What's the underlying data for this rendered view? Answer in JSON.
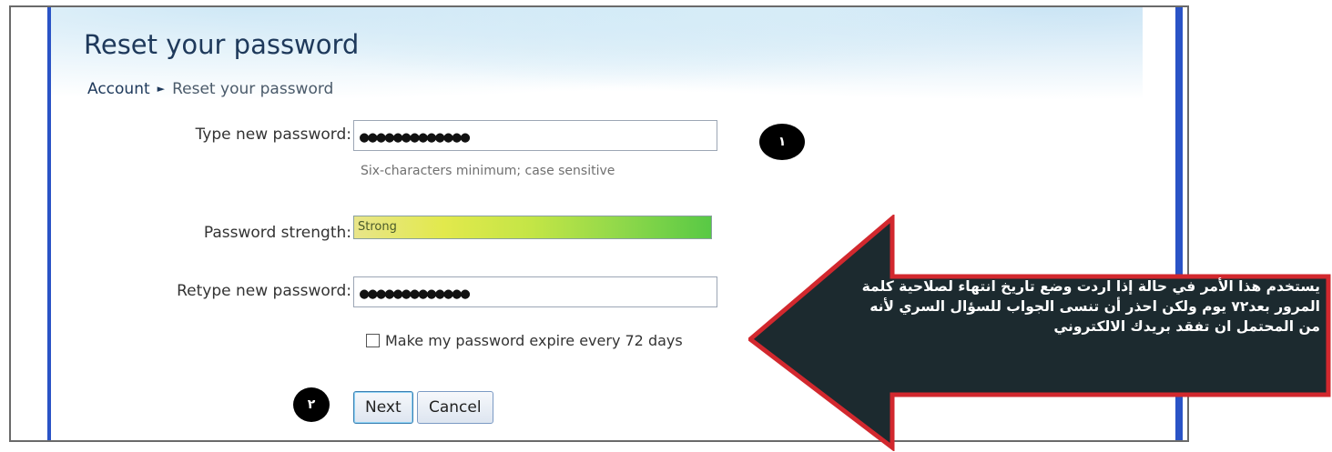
{
  "page": {
    "title": "Reset your password",
    "breadcrumb": {
      "parent": "Account",
      "separator": "►",
      "current": "Reset your password"
    }
  },
  "form": {
    "new_password": {
      "label": "Type new password:",
      "value": "●●●●●●●●●●●●●",
      "hint": "Six-characters minimum; case sensitive"
    },
    "strength": {
      "label": "Password strength:",
      "value": "Strong",
      "level": 1.0
    },
    "retype_password": {
      "label": "Retype new password:",
      "value": "●●●●●●●●●●●●●"
    },
    "expire_checkbox": {
      "label": "Make my password expire every 72 days",
      "checked": false
    }
  },
  "buttons": {
    "next": "Next",
    "cancel": "Cancel"
  },
  "badges": {
    "one": "١",
    "two": "٢"
  },
  "callout": {
    "text": "يستخدم هذا الأمر في حالة إذا اردت وضع تاريخ انتهاء لصلاحية كلمة المرور بعد٧٢ يوم ولكن احذر أن تنسى الجواب للسؤال السري لأنه من المحتمل ان تفقد بريدك الالكتروني",
    "arrow_fill": "#1c2a2f",
    "arrow_border": "#d2282e"
  },
  "colors": {
    "title": "#1e395b",
    "accent_blue": "#2a53c6"
  }
}
